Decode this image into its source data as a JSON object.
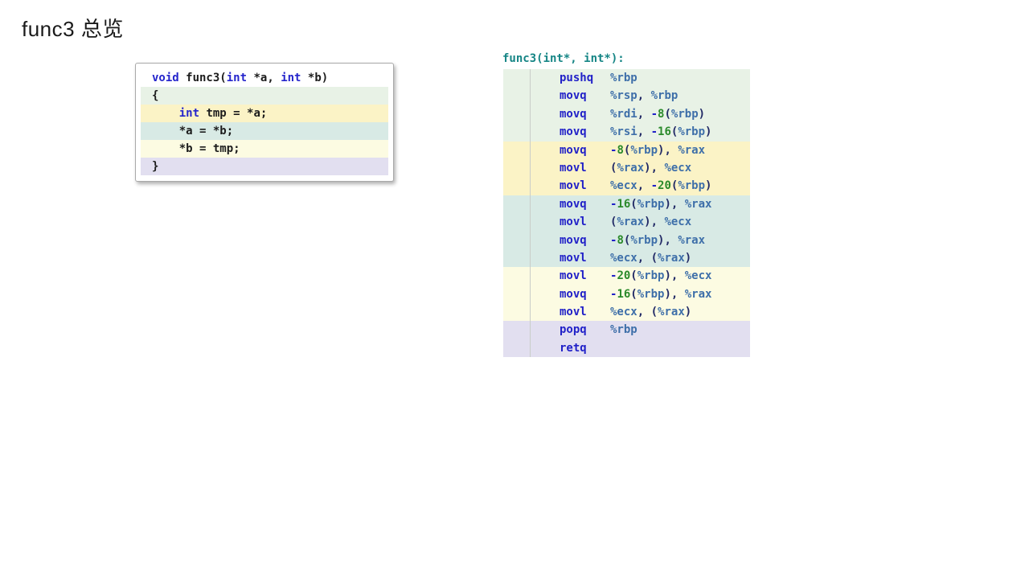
{
  "slide": {
    "title": "func3 总览"
  },
  "source_panel": {
    "language": "c",
    "lines": [
      {
        "text": "void func3(int *a, int *b)",
        "band": "none"
      },
      {
        "text": "{",
        "band": "green"
      },
      {
        "text": "    int tmp = *a;",
        "band": "yellow"
      },
      {
        "text": "    *a = *b;",
        "band": "teal"
      },
      {
        "text": "    *b = tmp;",
        "band": "ivory"
      },
      {
        "text": "}",
        "band": "lavender"
      }
    ]
  },
  "asm_panel": {
    "label": "func3(int*, int*):",
    "rows": [
      {
        "mnemonic": "pushq",
        "operands": "%rbp",
        "band": "green"
      },
      {
        "mnemonic": "movq",
        "operands": "%rsp, %rbp",
        "band": "green"
      },
      {
        "mnemonic": "movq",
        "operands": "%rdi, -8(%rbp)",
        "band": "green"
      },
      {
        "mnemonic": "movq",
        "operands": "%rsi, -16(%rbp)",
        "band": "green"
      },
      {
        "mnemonic": "movq",
        "operands": "-8(%rbp), %rax",
        "band": "yellow"
      },
      {
        "mnemonic": "movl",
        "operands": "(%rax), %ecx",
        "band": "yellow"
      },
      {
        "mnemonic": "movl",
        "operands": "%ecx, -20(%rbp)",
        "band": "yellow"
      },
      {
        "mnemonic": "movq",
        "operands": "-16(%rbp), %rax",
        "band": "teal"
      },
      {
        "mnemonic": "movl",
        "operands": "(%rax), %ecx",
        "band": "teal"
      },
      {
        "mnemonic": "movq",
        "operands": "-8(%rbp), %rax",
        "band": "teal"
      },
      {
        "mnemonic": "movl",
        "operands": "%ecx, (%rax)",
        "band": "teal"
      },
      {
        "mnemonic": "movl",
        "operands": "-20(%rbp), %ecx",
        "band": "ivory"
      },
      {
        "mnemonic": "movq",
        "operands": "-16(%rbp), %rax",
        "band": "ivory"
      },
      {
        "mnemonic": "movl",
        "operands": "%ecx, (%rax)",
        "band": "ivory"
      },
      {
        "mnemonic": "popq",
        "operands": "%rbp",
        "band": "lavender"
      },
      {
        "mnemonic": "retq",
        "operands": "",
        "band": "lavender"
      }
    ]
  },
  "colors": {
    "band_green": "#e8f2e6",
    "band_yellow": "#fbf3c6",
    "band_teal": "#d8eae5",
    "band_ivory": "#fcfbe2",
    "band_lavender": "#e2dff0",
    "keyword_blue": "#2525cc",
    "mnemonic_blue": "#2121c8",
    "register_blue": "#3e6fa9",
    "number_green": "#2b8a2b",
    "punctuation_navy": "#222a66",
    "asm_label_teal": "#158585"
  }
}
